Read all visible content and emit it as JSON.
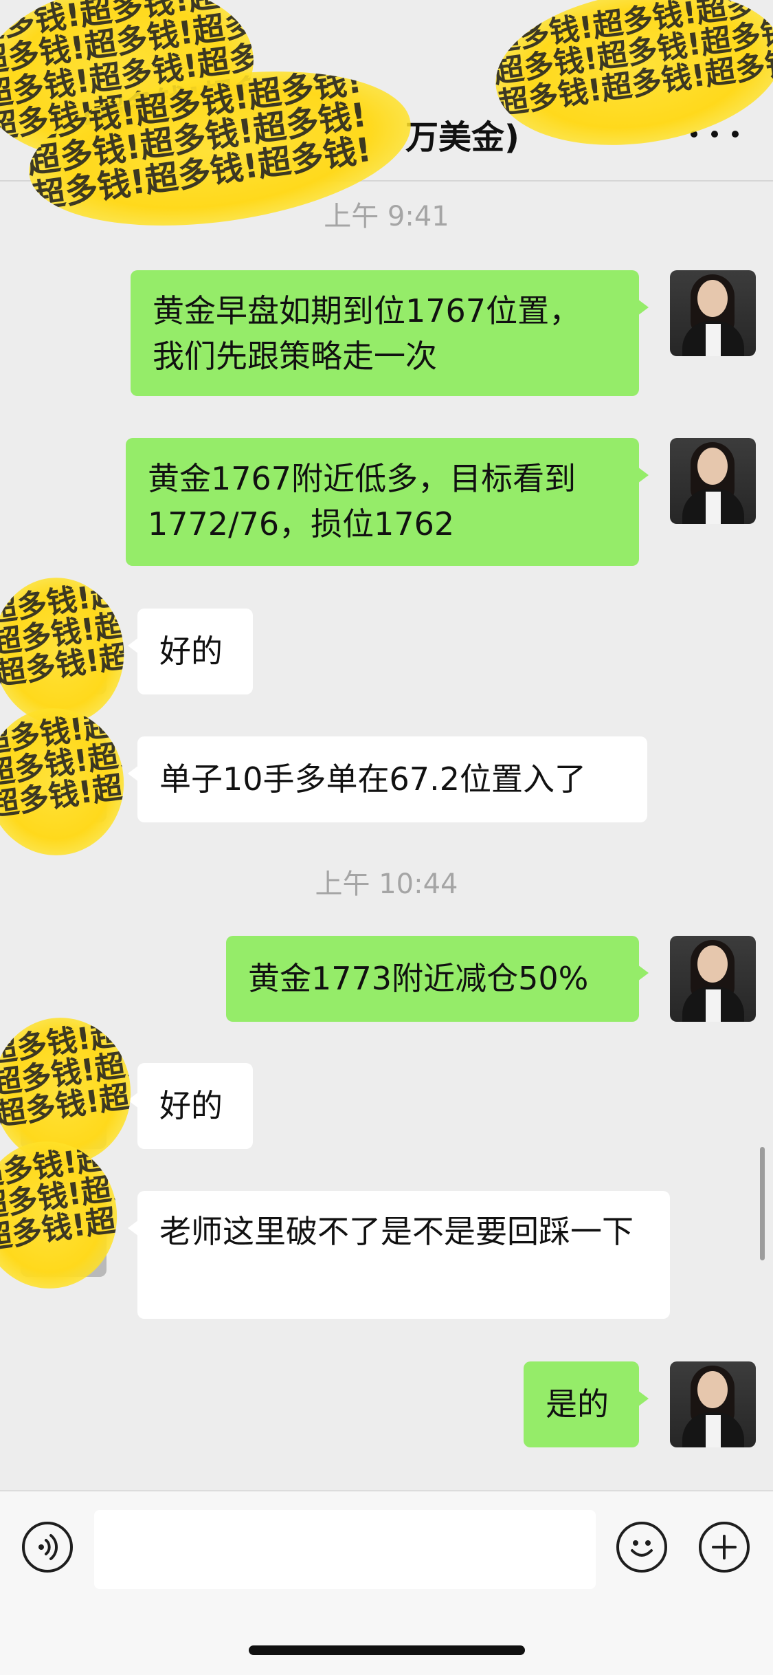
{
  "header": {
    "title": "万美金)"
  },
  "sticker_text": "超多钱!超多钱!超多钱!",
  "timestamps": {
    "t1": "上午 9:41",
    "t2": "上午 10:44"
  },
  "messages": [
    {
      "side": "out",
      "text": "黄金早盘如期到位1767位置，\n我们先跟策略走一次"
    },
    {
      "side": "out",
      "text": "黄金1767附近低多，目标看到1772/76，损位1762"
    },
    {
      "side": "in",
      "text": "好的"
    },
    {
      "side": "in",
      "text": "单子10手多单在67.2位置入了"
    },
    {
      "side": "out",
      "text": "黄金1773附近减仓50%"
    },
    {
      "side": "in",
      "text": "好的"
    },
    {
      "side": "in",
      "text": "老师这里破不了是不是要回踩一下"
    },
    {
      "side": "out",
      "text": "是的"
    }
  ],
  "input": {
    "value": "",
    "placeholder": ""
  },
  "icons": {
    "more": "more-horizontal-icon",
    "voice": "voice-icon",
    "emoji": "emoji-icon",
    "add": "plus-icon"
  },
  "colors": {
    "outgoing_bubble": "#95ec69",
    "incoming_bubble": "#ffffff",
    "background": "#ededed",
    "sticker": "#ffd91c"
  }
}
